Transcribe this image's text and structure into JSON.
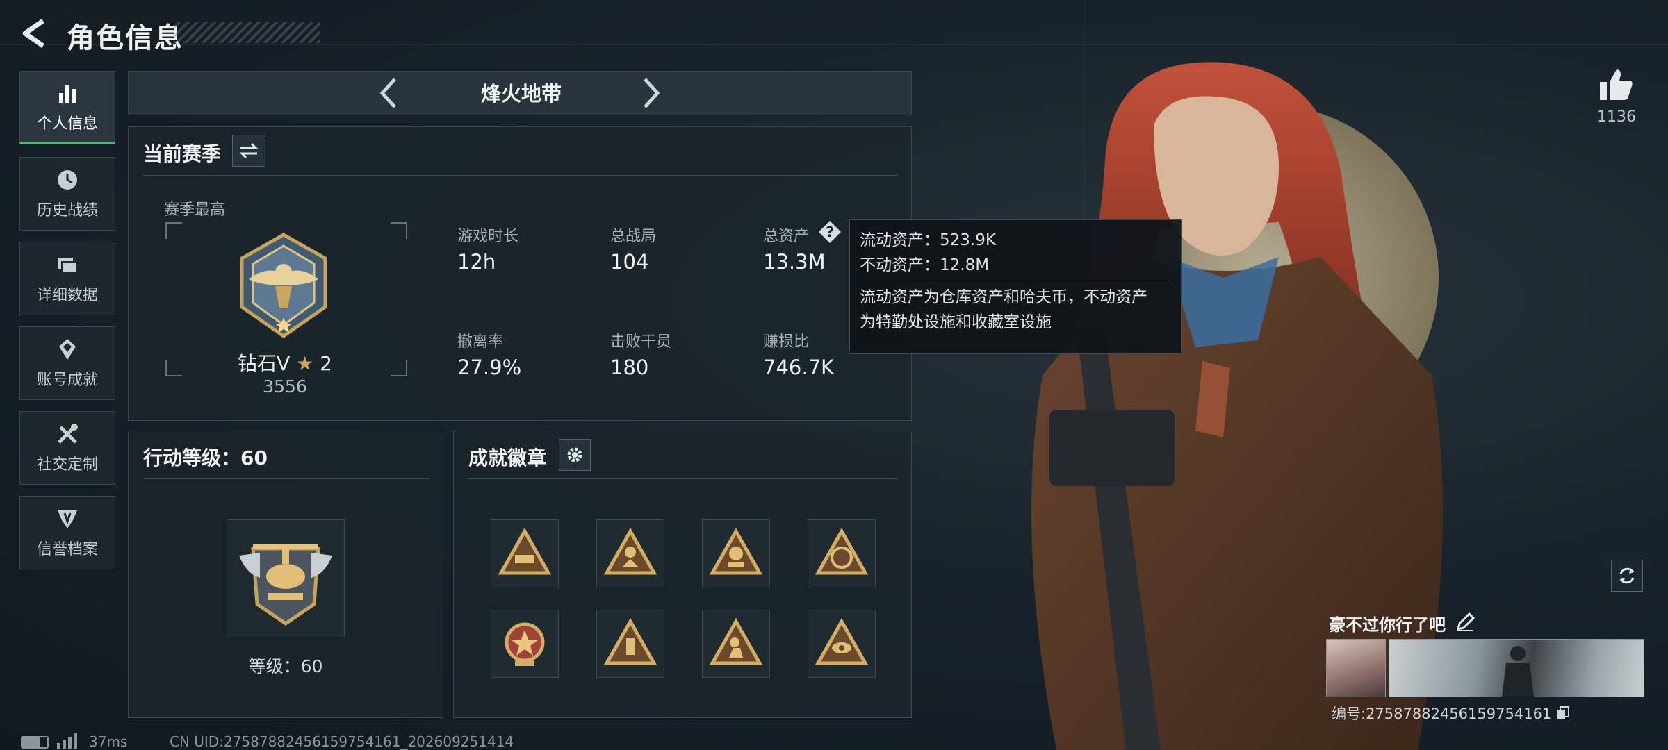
{
  "header": {
    "title": "角色信息"
  },
  "sidebar": {
    "items": [
      {
        "label": "个人信息",
        "icon": "bar-chart-icon",
        "active": true
      },
      {
        "label": "历史战绩",
        "icon": "clock-icon"
      },
      {
        "label": "详细数据",
        "icon": "folders-icon"
      },
      {
        "label": "账号成就",
        "icon": "achievement-icon"
      },
      {
        "label": "社交定制",
        "icon": "tools-icon"
      },
      {
        "label": "信誉档案",
        "icon": "shield-icon"
      }
    ]
  },
  "mode": {
    "title": "烽火地带"
  },
  "season": {
    "title": "当前赛季",
    "best_label": "赛季最高",
    "rank_name": "钻石V",
    "rank_stars": "2",
    "rank_score": "3556",
    "stats": [
      {
        "label": "游戏时长",
        "value": "12h"
      },
      {
        "label": "总战局",
        "value": "104"
      },
      {
        "label": "总资产",
        "value": "13.3M"
      },
      {
        "label": "撤离率",
        "value": "27.9%"
      },
      {
        "label": "击败干员",
        "value": "180"
      },
      {
        "label": "赚损比",
        "value": "746.7K"
      }
    ]
  },
  "tooltip": {
    "liquid": "流动资产：523.9K",
    "fixed": "不动资产：12.8M",
    "desc_1": "流动资产为仓库资产和哈夫币，不动资产",
    "desc_2": "为特勤处设施和收藏室设施"
  },
  "action_level": {
    "title": "行动等级：60",
    "level_text": "等级：60"
  },
  "badges": {
    "title": "成就徽章",
    "items": [
      "badge-vehicle-icon",
      "badge-climber-icon",
      "badge-masked-icon",
      "badge-eri-icon",
      "badge-star-icon",
      "badge-device-icon",
      "badge-soldier-icon",
      "badge-eye-icon"
    ]
  },
  "likes": {
    "count": "1136"
  },
  "profile": {
    "nickname": "豪不过你行了吧",
    "uid_label": "编号:275878824561597541​61"
  },
  "footer": {
    "ping": "37ms",
    "uid": "CN UID:275878824561597541​61_202609251414"
  },
  "colors": {
    "accent": "#3ec07a",
    "gold": "#c8a35a",
    "hair": "#a8402e"
  }
}
